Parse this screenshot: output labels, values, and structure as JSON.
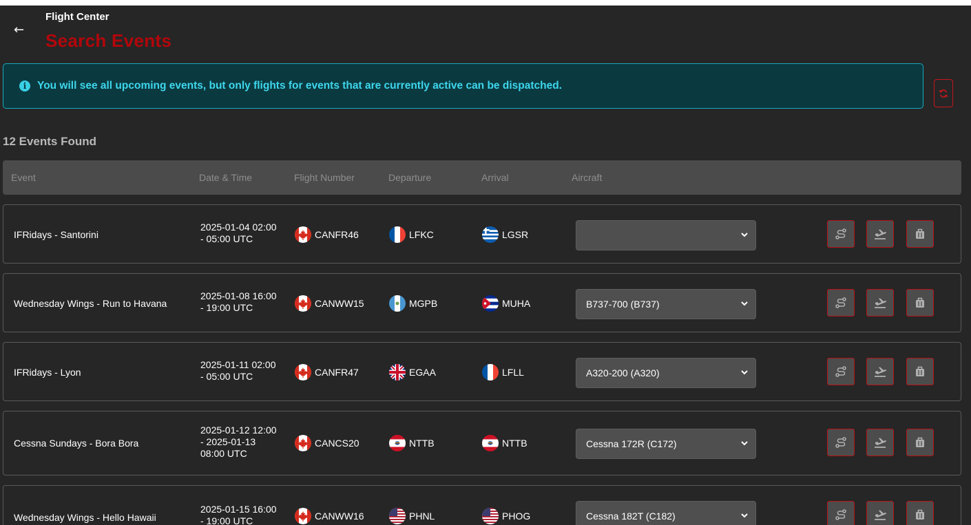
{
  "header": {
    "back_icon": "arrow-left-icon",
    "app_title": "Flight Center",
    "page_title": "Search Events"
  },
  "alert": {
    "icon": "info-circle-icon",
    "text": "You will see all upcoming events, but only flights for events that are currently active can be dispatched."
  },
  "refresh_icon": "refresh-icon",
  "results": {
    "count_label": "12 Events Found"
  },
  "table": {
    "columns": [
      "Event",
      "Date & Time",
      "Flight Number",
      "Departure",
      "Arrival",
      "Aircraft"
    ],
    "rows": [
      {
        "event": "IFRidays - Santorini",
        "datetime": [
          "2025-01-04 02:00",
          "- 05:00 UTC"
        ],
        "flight_number": "CANFR46",
        "flight_flag": "canada",
        "departure": "LFKC",
        "departure_flag": "france",
        "arrival": "LGSR",
        "arrival_flag": "greece",
        "aircraft": ""
      },
      {
        "event": "Wednesday Wings - Run to Havana",
        "datetime": [
          "2025-01-08 16:00",
          "- 19:00 UTC"
        ],
        "flight_number": "CANWW15",
        "flight_flag": "canada",
        "departure": "MGPB",
        "departure_flag": "guatemala",
        "arrival": "MUHA",
        "arrival_flag": "cuba",
        "aircraft": "B737-700 (B737)"
      },
      {
        "event": "IFRidays - Lyon",
        "datetime": [
          "2025-01-11 02:00",
          "- 05:00 UTC"
        ],
        "flight_number": "CANFR47",
        "flight_flag": "canada",
        "departure": "EGAA",
        "departure_flag": "united-kingdom",
        "arrival": "LFLL",
        "arrival_flag": "france",
        "aircraft": "A320-200 (A320)"
      },
      {
        "event": "Cessna Sundays - Bora Bora",
        "datetime": [
          "2025-01-12 12:00",
          "- 2025-01-13",
          "08:00 UTC"
        ],
        "flight_number": "CANCS20",
        "flight_flag": "canada",
        "departure": "NTTB",
        "departure_flag": "french-polynesia",
        "arrival": "NTTB",
        "arrival_flag": "french-polynesia",
        "aircraft": "Cessna 172R (C172)"
      },
      {
        "event": "Wednesday Wings - Hello Hawaii",
        "datetime": [
          "2025-01-15 16:00",
          "- 19:00 UTC"
        ],
        "flight_number": "CANWW16",
        "flight_flag": "canada",
        "departure": "PHNL",
        "departure_flag": "united-states",
        "arrival": "PHOG",
        "arrival_flag": "united-states",
        "aircraft": "Cessna 182T (C182)"
      }
    ],
    "row_actions": [
      "route-icon",
      "plane-departure-icon",
      "luggage-icon"
    ]
  },
  "colors": {
    "accent_red": "#b3060b",
    "alert_bg": "#0a3a40",
    "alert_text": "#3ed6ec",
    "background": "#262626"
  }
}
